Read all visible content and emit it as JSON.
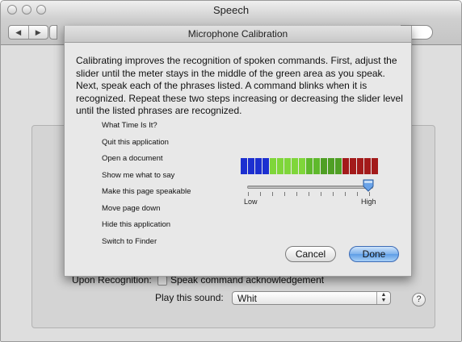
{
  "window": {
    "title": "Speech"
  },
  "nav": {
    "back_icon": "◀",
    "forward_icon": "▶"
  },
  "sheet": {
    "title": "Microphone Calibration",
    "instructions": "Calibrating improves the recognition of spoken commands. First, adjust the slider until the meter stays in the middle of the green area as you speak. Next, speak each of the phrases listed. A command blinks when it is recognized. Repeat these two steps increasing or decreasing the slider level until the listed phrases are recognized.",
    "phrases": [
      "What Time Is It?",
      "Quit this application",
      "Open a document",
      "Show me what to say",
      "Make this page speakable",
      "Move page down",
      "Hide this application",
      "Switch to Finder"
    ],
    "meter": {
      "colors": [
        "#1c2fd0",
        "#1c2fd0",
        "#1c2fd0",
        "#1c2fd0",
        "#7fd63a",
        "#7fd63a",
        "#7fd63a",
        "#7fd63a",
        "#7fd63a",
        "#5fb92c",
        "#5fb92c",
        "#4f9f24",
        "#4f9f24",
        "#4f9f24",
        "#a31a1a",
        "#a31a1a",
        "#a31a1a",
        "#a31a1a",
        "#a31a1a"
      ]
    },
    "slider": {
      "low_label": "Low",
      "high_label": "High",
      "level": 0.92
    },
    "cancel_label": "Cancel",
    "done_label": "Done"
  },
  "upon_recognition": {
    "label": "Upon Recognition:",
    "checkbox_label": "Speak command acknowledgement",
    "checked": false,
    "sound_label": "Play this sound:",
    "sound_value": "Whit"
  },
  "help": "?"
}
